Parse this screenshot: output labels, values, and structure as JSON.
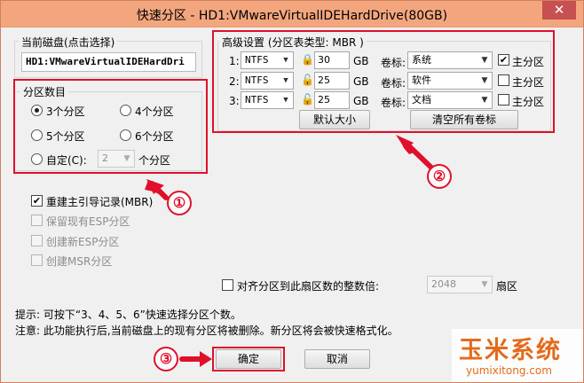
{
  "window": {
    "title": "快速分区 - HD1:VMwareVirtualIDEHardDrive(80GB)",
    "close_label": "✕"
  },
  "current_disk": {
    "label": "当前磁盘(点击选择)",
    "value": "HD1:VMwareVirtualIDEHardDri"
  },
  "partition_count": {
    "label": "分区数目",
    "options": [
      {
        "label": "3个分区",
        "selected": true
      },
      {
        "label": "4个分区",
        "selected": false
      },
      {
        "label": "5个分区",
        "selected": false
      },
      {
        "label": "6个分区",
        "selected": false
      }
    ],
    "custom_label": "自定(C):",
    "custom_value": "2",
    "custom_suffix": "个分区"
  },
  "options": {
    "rebuild_mbr": {
      "label": "重建主引导记录(MBR)",
      "checked": true
    },
    "keep_esp": {
      "label": "保留现有ESP分区",
      "disabled": true
    },
    "create_esp": {
      "label": "创建新ESP分区",
      "disabled": true
    },
    "create_msr": {
      "label": "创建MSR分区",
      "disabled": true
    }
  },
  "advanced": {
    "label": "高级设置 (分区表类型: MBR )",
    "rows": [
      {
        "index": "1:",
        "fs": "NTFS",
        "size": "30",
        "unit": "GB",
        "vol_label_text": "卷标:",
        "vol": "系统",
        "primary_label": "主分区",
        "primary": true
      },
      {
        "index": "2:",
        "fs": "NTFS",
        "size": "25",
        "unit": "GB",
        "vol_label_text": "卷标:",
        "vol": "软件",
        "primary_label": "主分区",
        "primary": false
      },
      {
        "index": "3:",
        "fs": "NTFS",
        "size": "25",
        "unit": "GB",
        "vol_label_text": "卷标:",
        "vol": "文档",
        "primary_label": "主分区",
        "primary": false
      }
    ],
    "default_size_button": "默认大小",
    "clear_labels_button": "清空所有卷标"
  },
  "align": {
    "label": "对齐分区到此扇区数的整数倍:",
    "value": "2048",
    "unit": "扇区"
  },
  "hints": {
    "line1": "提示: 可按下“3、4、5、6”快速选择分区个数。",
    "line2": "注意: 此功能执行后,当前磁盘上的现有分区将被删除。新分区将会被快速格式化。"
  },
  "buttons": {
    "ok": "确定",
    "cancel": "取消"
  },
  "callouts": {
    "one": "①",
    "two": "②",
    "three": "③"
  },
  "watermark": {
    "main": "玉米系统",
    "sub": "yumixitong.com"
  },
  "icons": {
    "lock": "lock-icon",
    "dropdown": "chevron-down-icon",
    "check": "✔"
  },
  "colors": {
    "titlebar": "#f3a67e",
    "highlight": "#e0102b",
    "watermark": "#e46a1b"
  }
}
